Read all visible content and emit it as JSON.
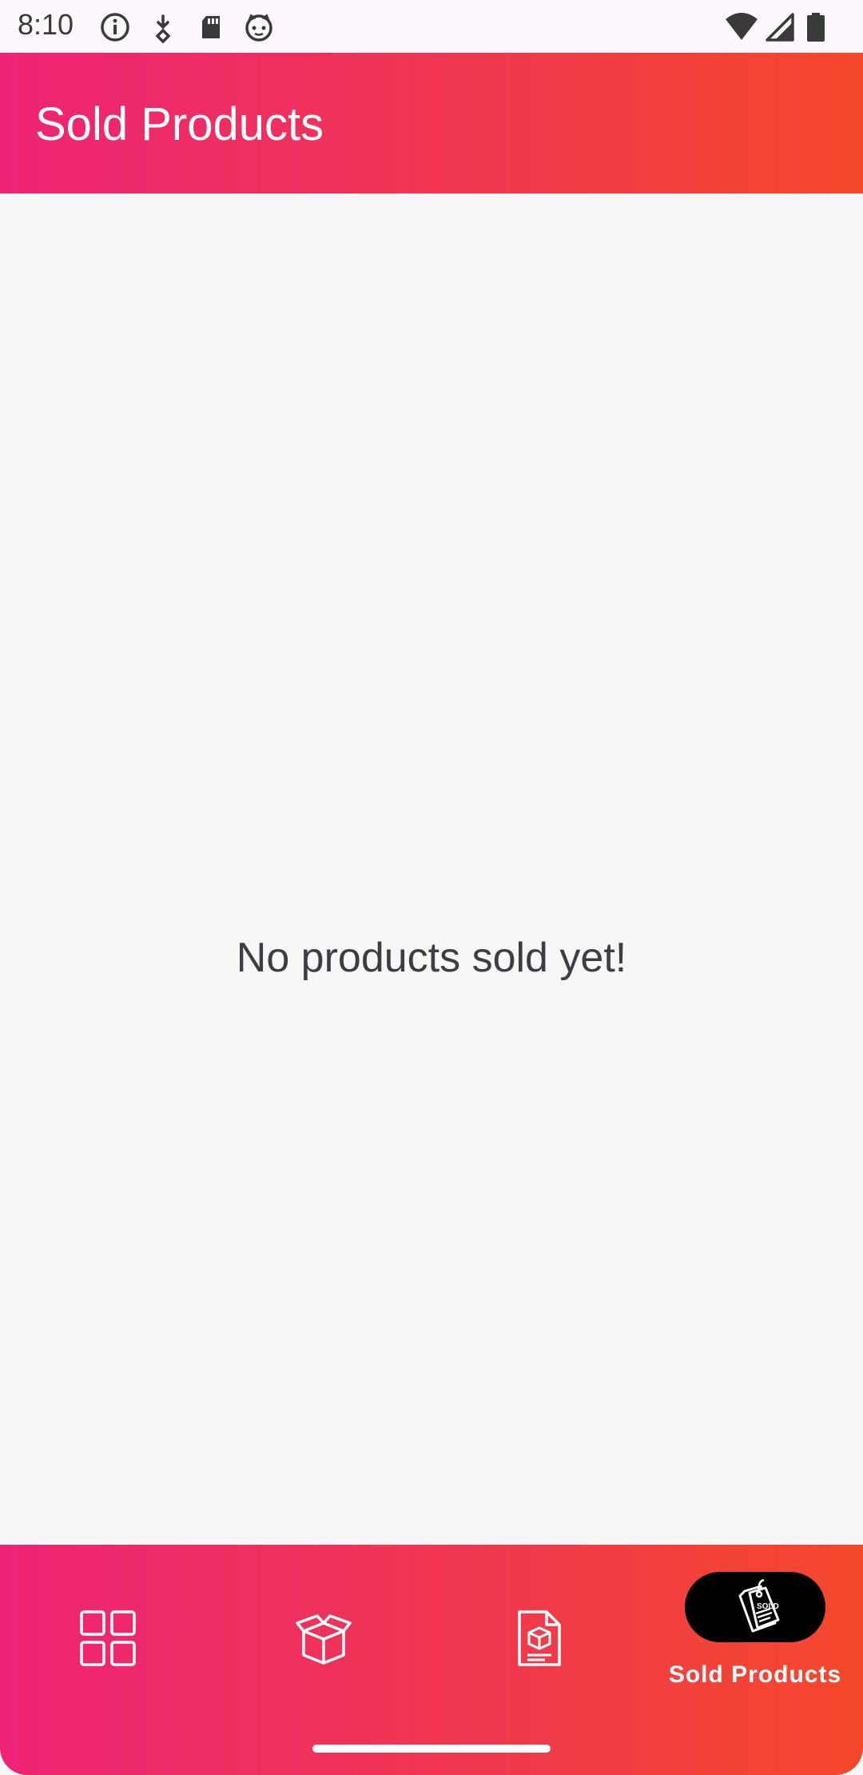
{
  "status_bar": {
    "time": "8:10",
    "left_icons": [
      "info-icon",
      "download-icon",
      "sd-card-icon",
      "cat-face-icon"
    ],
    "right_icons": [
      "wifi-icon",
      "cellular-signal-icon",
      "battery-icon"
    ]
  },
  "app_bar": {
    "title": "Sold Products"
  },
  "content": {
    "empty_message": "No products sold yet!"
  },
  "bottom_nav": {
    "items": [
      {
        "icon": "dashboard-grid-icon",
        "label": ""
      },
      {
        "icon": "open-box-icon",
        "label": ""
      },
      {
        "icon": "product-document-icon",
        "label": ""
      },
      {
        "icon": "sold-tag-icon",
        "label": "Sold Products",
        "active": true
      }
    ],
    "sold_tag_text": "SOLD"
  },
  "colors": {
    "gradient_start": "#ee2375",
    "gradient_end": "#f4482b",
    "background": "#f7f7f7",
    "active_pill": "#000000",
    "text_dark": "#3d3d44"
  }
}
